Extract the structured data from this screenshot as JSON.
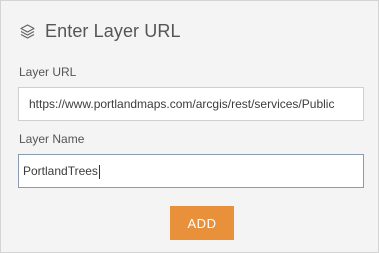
{
  "header": {
    "icon": "layers-icon",
    "title": "Enter Layer URL"
  },
  "fields": {
    "url": {
      "label": "Layer URL",
      "value": "https://www.portlandmaps.com/arcgis/rest/services/Public"
    },
    "name": {
      "label": "Layer Name",
      "value": "PortlandTrees"
    }
  },
  "actions": {
    "add_label": "ADD"
  },
  "colors": {
    "accent": "#e8913a",
    "panel_background": "#f4f4f4",
    "text": "#555555"
  }
}
